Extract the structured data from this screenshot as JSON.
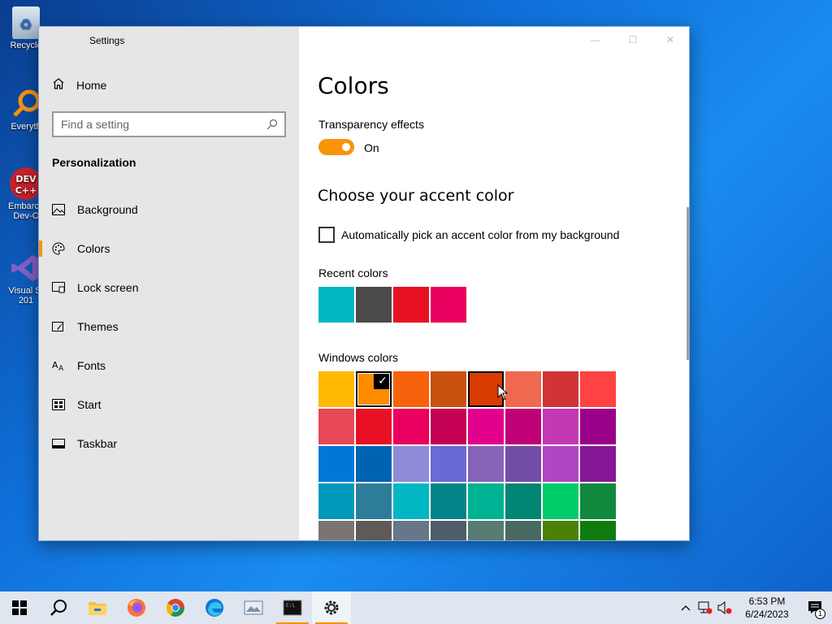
{
  "desktop": {
    "icons": [
      {
        "label": "Recycle",
        "name": "recycle-bin"
      },
      {
        "label": "Everyth",
        "name": "everything"
      },
      {
        "label": "Embarca",
        "label2": "Dev-C",
        "name": "devcpp"
      },
      {
        "label": "Visual St",
        "label2": "201",
        "name": "visual-studio"
      }
    ]
  },
  "window": {
    "title": "Settings",
    "sidebar": {
      "home_label": "Home",
      "search_placeholder": "Find a setting",
      "section": "Personalization",
      "items": [
        {
          "label": "Background",
          "icon": "picture-icon"
        },
        {
          "label": "Colors",
          "icon": "palette-icon",
          "active": true
        },
        {
          "label": "Lock screen",
          "icon": "lock-screen-icon"
        },
        {
          "label": "Themes",
          "icon": "themes-icon"
        },
        {
          "label": "Fonts",
          "icon": "fonts-icon"
        },
        {
          "label": "Start",
          "icon": "start-icon"
        },
        {
          "label": "Taskbar",
          "icon": "taskbar-icon"
        }
      ]
    },
    "content": {
      "title": "Colors",
      "transparency_label": "Transparency effects",
      "transparency_state": "On",
      "accent_heading": "Choose your accent color",
      "auto_pick_label": "Automatically pick an accent color from my background",
      "auto_pick_checked": false,
      "recent_label": "Recent colors",
      "recent_colors": [
        "#00b7c3",
        "#4c4a48",
        "#e81123",
        "#ea005e"
      ],
      "windows_label": "Windows colors",
      "windows_colors": [
        "#ffb900",
        "#ff8c00",
        "#f7630c",
        "#ca5010",
        "#da3b01",
        "#ef6950",
        "#d13438",
        "#ff4343",
        "#e74856",
        "#e81123",
        "#ea005e",
        "#c30052",
        "#e3008c",
        "#bf0077",
        "#c239b3",
        "#9a0089",
        "#0078d7",
        "#0063b1",
        "#8e8cd8",
        "#6b69d6",
        "#8764b8",
        "#744da9",
        "#b146c2",
        "#881798",
        "#0099bc",
        "#2d7d9a",
        "#00b7c3",
        "#038387",
        "#00b294",
        "#018574",
        "#00cc6a",
        "#10893e",
        "#7a7574",
        "#5d5a58",
        "#68768a",
        "#515c6b",
        "#567c73",
        "#486860",
        "#498205",
        "#107c10"
      ],
      "selected_index": 1,
      "hover_index": 4
    }
  },
  "taskbar": {
    "apps": [
      "start-icon",
      "search-icon",
      "file-explorer-icon",
      "firefox-icon",
      "chrome-icon",
      "edge-icon",
      "photos-icon",
      "terminal-icon",
      "settings-icon"
    ],
    "time": "6:53 PM",
    "date": "6/24/2023",
    "notification_count": "1"
  },
  "colors": {
    "accent": "#f7940a"
  }
}
